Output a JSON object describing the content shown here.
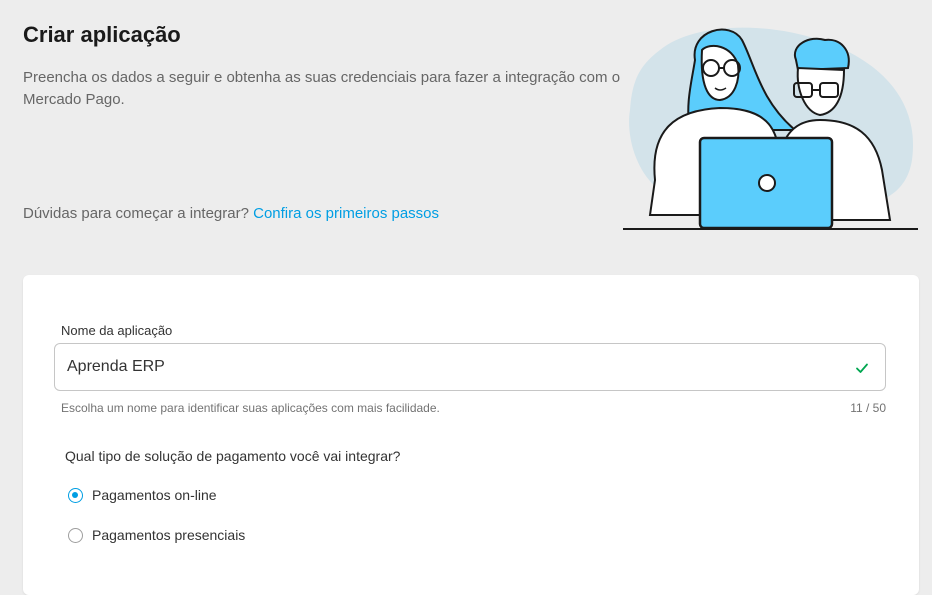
{
  "header": {
    "title": "Criar aplicação",
    "description": "Preencha os dados a seguir e obtenha as suas credenciais para fazer a integração com o Mercado Pago.",
    "help_text": "Dúvidas para começar a integrar?",
    "help_link": "Confira os primeiros passos"
  },
  "form": {
    "name_field": {
      "label": "Nome da aplicação",
      "value": "Aprenda ERP",
      "helper": "Escolha um nome para identificar suas aplicações com mais facilidade.",
      "counter": "11 / 50",
      "valid_icon": "check-icon"
    },
    "payment_question": "Qual tipo de solução de pagamento você vai integrar?",
    "payment_options": [
      {
        "label": "Pagamentos on-line",
        "selected": true
      },
      {
        "label": "Pagamentos presenciais",
        "selected": false
      }
    ]
  },
  "colors": {
    "accent": "#009ee3",
    "valid": "#00a650",
    "illustration_blue": "#5bcdfc",
    "background": "#ededed"
  }
}
